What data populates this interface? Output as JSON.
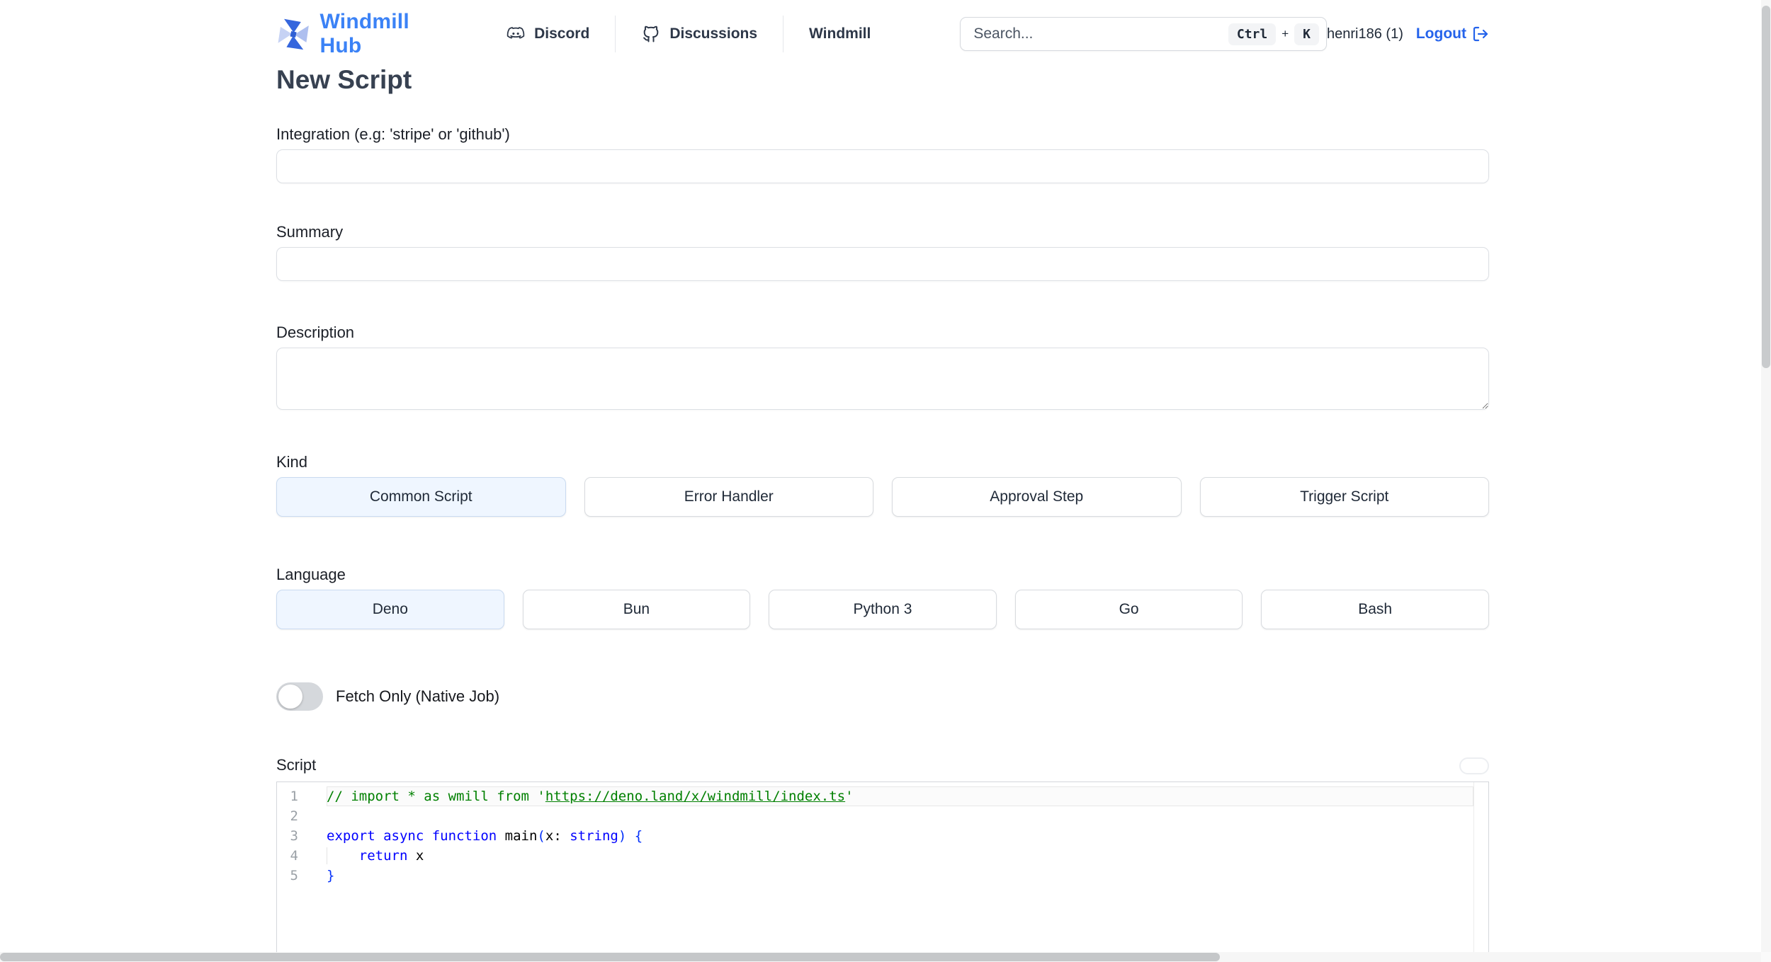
{
  "header": {
    "brand": "Windmill Hub",
    "nav": [
      {
        "label": "Discord",
        "icon": "discord-icon"
      },
      {
        "label": "Discussions",
        "icon": "github-icon"
      },
      {
        "label": "Windmill",
        "icon": null
      }
    ],
    "search": {
      "placeholder": "Search...",
      "kbd_ctrl": "Ctrl",
      "kbd_plus": "+",
      "kbd_k": "K"
    },
    "user": "henri186 (1)",
    "logout_label": "Logout"
  },
  "page": {
    "title": "New Script"
  },
  "form": {
    "integration": {
      "label": "Integration (e.g: 'stripe' or 'github')",
      "value": ""
    },
    "summary": {
      "label": "Summary",
      "value": ""
    },
    "description": {
      "label": "Description",
      "value": ""
    },
    "kind": {
      "label": "Kind",
      "options": [
        {
          "label": "Common Script",
          "selected": true
        },
        {
          "label": "Error Handler",
          "selected": false
        },
        {
          "label": "Approval Step",
          "selected": false
        },
        {
          "label": "Trigger Script",
          "selected": false
        }
      ]
    },
    "language": {
      "label": "Language",
      "options": [
        {
          "label": "Deno",
          "selected": true
        },
        {
          "label": "Bun",
          "selected": false
        },
        {
          "label": "Python 3",
          "selected": false
        },
        {
          "label": "Go",
          "selected": false
        },
        {
          "label": "Bash",
          "selected": false
        }
      ]
    },
    "fetch_only": {
      "label": "Fetch Only (Native Job)",
      "enabled": false
    },
    "script": {
      "label": "Script"
    }
  },
  "editor": {
    "lines": [
      {
        "num": "1",
        "current": true,
        "tokens": [
          [
            "comment",
            "// import * as wmill from '"
          ],
          [
            "comment-link",
            "https://deno.land/x/windmill/index.ts"
          ],
          [
            "comment",
            "'"
          ]
        ]
      },
      {
        "num": "2",
        "tokens": []
      },
      {
        "num": "3",
        "tokens": [
          [
            "keyword",
            "export async function"
          ],
          [
            "plain",
            " main"
          ],
          [
            "bracket",
            "("
          ],
          [
            "plain",
            "x: "
          ],
          [
            "keyword",
            "string"
          ],
          [
            "bracket",
            ")"
          ],
          [
            "bracket",
            " {"
          ]
        ]
      },
      {
        "num": "4",
        "indent_guide": true,
        "tokens": [
          [
            "plain",
            "    "
          ],
          [
            "keyword",
            "return"
          ],
          [
            "plain",
            " x"
          ]
        ]
      },
      {
        "num": "5",
        "tokens": [
          [
            "bracket",
            "}"
          ]
        ]
      }
    ]
  },
  "colors": {
    "brand": "#3b82f6",
    "accent": "#2563eb",
    "selected_bg": "#eff6ff",
    "token_comment": "#008000",
    "token_keyword": "#0000ff",
    "token_bracket": "#0431fa",
    "token_plain": "#000000"
  }
}
